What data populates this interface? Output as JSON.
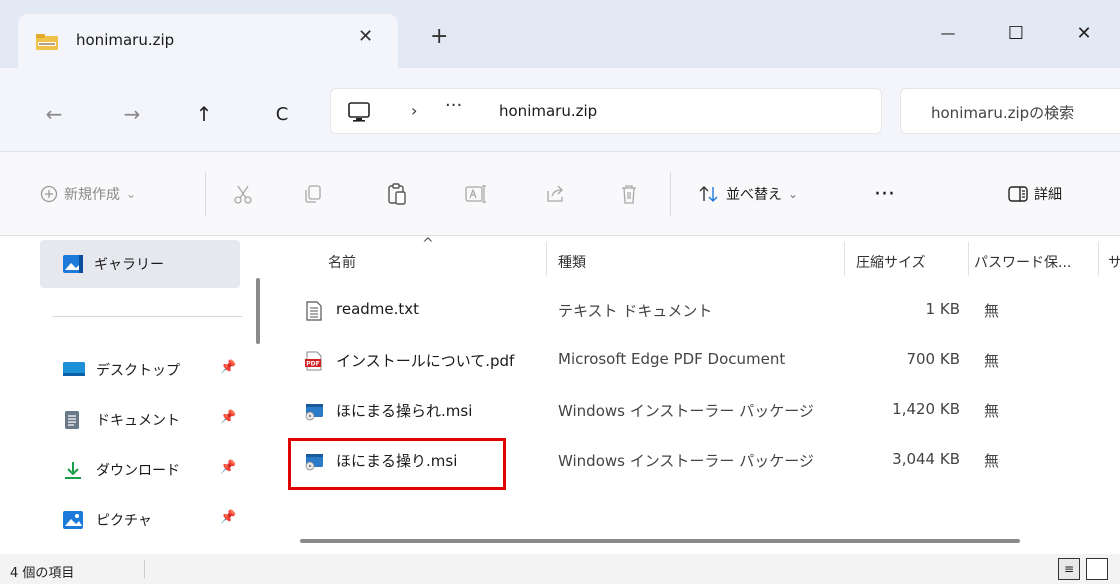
{
  "window": {
    "tab_title": "honimaru.zip",
    "tab_close": "✕",
    "new_tab": "+",
    "minimize": "—",
    "maximize": "☐",
    "close": "✕"
  },
  "nav": {
    "back": "←",
    "forward": "→",
    "up": "↑",
    "refresh": "C",
    "separator": "›",
    "more": "···",
    "address": "honimaru.zip",
    "search_placeholder": "honimaru.zipの検索"
  },
  "toolbar": {
    "new_label": "新規作成",
    "new_chevron": "⌄",
    "sort_label": "並べ替え",
    "sort_chevron": "⌄",
    "more": "···",
    "details_label": "詳細"
  },
  "sidebar": {
    "gallery_label": "ギャラリー",
    "items": [
      {
        "label": "デスクトップ",
        "icon": "desktop-icon",
        "color": "#1e90d8"
      },
      {
        "label": "ドキュメント",
        "icon": "documents-icon",
        "color": "#6a7a8a"
      },
      {
        "label": "ダウンロード",
        "icon": "download-icon",
        "color": "#1a9e4a"
      },
      {
        "label": "ピクチャ",
        "icon": "pictures-icon",
        "color": "#1e7ad8"
      }
    ]
  },
  "columns": {
    "name": "名前",
    "type": "種類",
    "compressed_size": "圧縮サイズ",
    "password": "パスワード保...",
    "extra": "サ",
    "sort_caret": "^"
  },
  "files": [
    {
      "name": "readme.txt",
      "type": "テキスト ドキュメント",
      "size": "1 KB",
      "password": "無",
      "icon": "text-file-icon"
    },
    {
      "name": "インストールについて.pdf",
      "type": "Microsoft Edge PDF Document",
      "size": "700 KB",
      "password": "無",
      "icon": "pdf-file-icon"
    },
    {
      "name": "ほにまる操られ.msi",
      "type": "Windows インストーラー パッケージ",
      "size": "1,420 KB",
      "password": "無",
      "icon": "msi-installer-icon"
    },
    {
      "name": "ほにまる操り.msi",
      "type": "Windows インストーラー パッケージ",
      "size": "3,044 KB",
      "password": "無",
      "icon": "msi-installer-icon"
    }
  ],
  "status": {
    "item_count": "4 個の項目"
  },
  "colors": {
    "highlight": "#e00000",
    "accent": "#1e7ad8"
  }
}
